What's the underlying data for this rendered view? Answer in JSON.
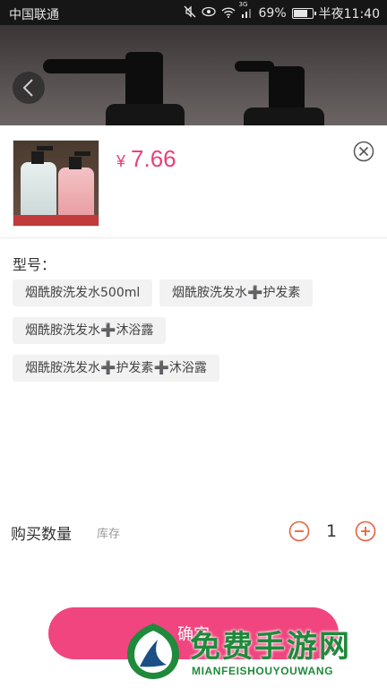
{
  "status_bar": {
    "carrier": "中国联通",
    "network": "3G",
    "battery": "69%",
    "time": "半夜11:40",
    "battery_level": 0.69,
    "icons": [
      "mute-icon",
      "eye-icon",
      "wifi-icon",
      "signal-icon",
      "battery-icon"
    ]
  },
  "header": {
    "back_icon": "chevron-left-icon"
  },
  "product": {
    "currency": "¥",
    "price": "7.66",
    "close_icon": "close-circle-icon"
  },
  "spec": {
    "label": "型号：",
    "options": [
      {
        "parts": [
          "烟酰胺洗发水500ml"
        ]
      },
      {
        "parts": [
          "烟酰胺洗发水",
          "护发素"
        ]
      },
      {
        "parts": [
          "烟酰胺洗发水",
          "沐浴露"
        ]
      },
      {
        "parts": [
          "烟酰胺洗发水",
          "护发素",
          "沐浴露"
        ]
      }
    ],
    "plus_glyph": "➕"
  },
  "quantity": {
    "label": "购买数量",
    "stock_label": "库存",
    "value": "1",
    "minus_icon": "minus-circle-icon",
    "plus_icon": "plus-circle-icon"
  },
  "confirm": {
    "label": "确定"
  },
  "watermark": {
    "title": "免费手游网",
    "subtitle": "MIANFEISHOUYOUWANG"
  },
  "colors": {
    "accent": "#f0457f",
    "price": "#e8407a",
    "qty_icon": "#e8603c",
    "watermark": "#1f8a3b"
  }
}
